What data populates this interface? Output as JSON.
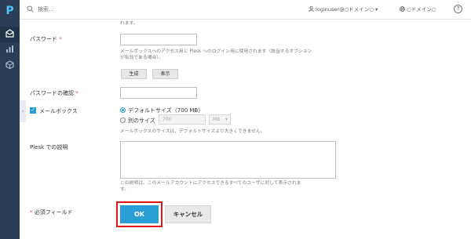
{
  "sidebar": {
    "logo_letter": "P",
    "icons": [
      "mail-icon",
      "stats-icon",
      "extensions-icon"
    ]
  },
  "topbar": {
    "search_placeholder": "検索...",
    "user_label": "loginuser@○ドメイン○",
    "domain_label": "○ドメイン○",
    "help_label": "?"
  },
  "form": {
    "top_hint_tail": "れます。",
    "password": {
      "label": "パスワード",
      "required_mark": "*",
      "hint_line1": "メールボックスへのアクセス用と Plesk へのログイン用に使用されます（該当するオプション",
      "hint_line2": "が有効である場合）。",
      "generate_label": "生成",
      "show_label": "表示"
    },
    "password_confirm": {
      "label": "パスワードの確認",
      "required_mark": "*"
    },
    "mailbox": {
      "label": "メールボックス",
      "checked": true,
      "default_size_label": "デフォルトサイズ（700 MB）",
      "other_size_label": "別のサイズ",
      "size_value": "700",
      "size_unit": "MB",
      "hint": "メールボックスのサイズは、デフォルトサイズより大きくできません。"
    },
    "description": {
      "label": "Plesk での説明",
      "hint_line1": "この説明は、このメールアカウントにアクセスできるすべてのユーザに対して表示されま",
      "hint_line2": "す。"
    },
    "required_note_mark": "*",
    "required_note": "必須フィールド",
    "ok_label": "OK",
    "cancel_label": "キャンセル"
  },
  "colors": {
    "sidebar_bg": "#2b3e55",
    "accent": "#2a9fd6",
    "highlight_border": "#e0161b"
  }
}
